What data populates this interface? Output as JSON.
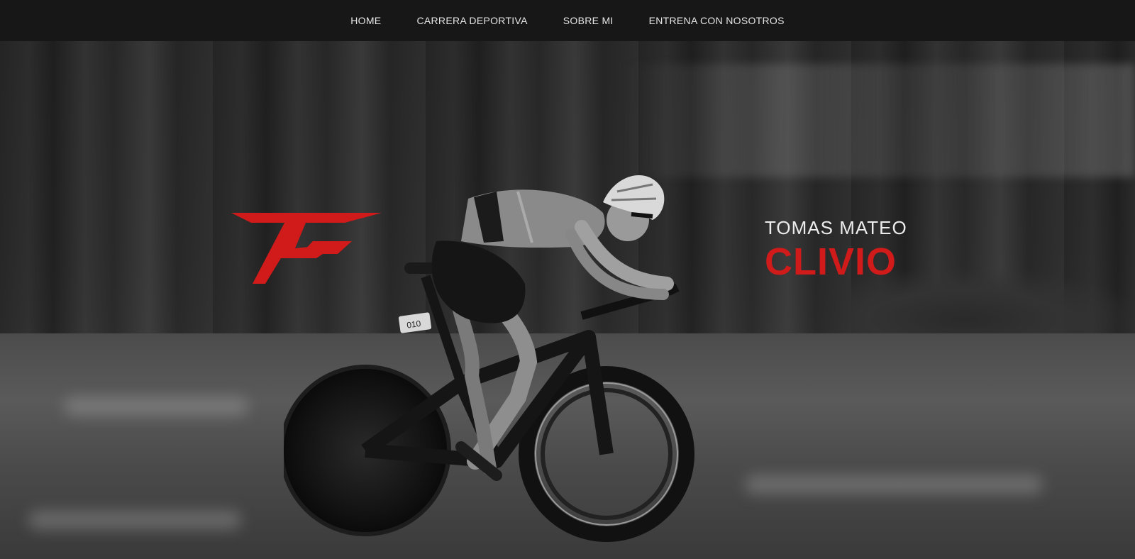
{
  "nav": {
    "items": [
      {
        "label": "HOME"
      },
      {
        "label": "CARRERA DEPORTIVA"
      },
      {
        "label": "SOBRE MI"
      },
      {
        "label": "ENTRENA CON NOSOTROS"
      }
    ]
  },
  "hero": {
    "logo_icon": "tc-monogram-logo",
    "first_name": "TOMAS MATEO",
    "last_name": "CLIVIO",
    "bib_number": "010"
  },
  "colors": {
    "accent": "#d11a1a",
    "nav_background": "#141414",
    "text_light": "#ececec"
  }
}
